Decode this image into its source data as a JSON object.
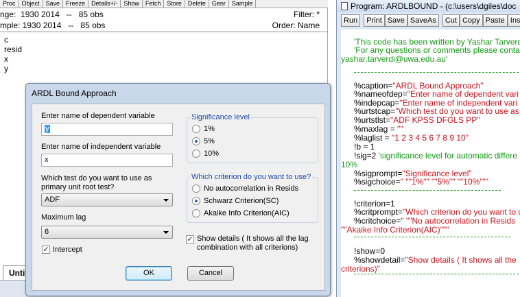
{
  "workfile": {
    "toolbar_items": [
      "Proc",
      "Object",
      "Save",
      "Freeze",
      "Details+/-",
      "Show",
      "Fetch",
      "Store",
      "Delete",
      "Genr",
      "Sample"
    ],
    "range_label": "nge:  1930 2014   --   85 obs",
    "filter_label": "Filter: *",
    "sample_label": "mple: 1930 2014   --   85 obs",
    "order_label": "Order: Name",
    "objects": [
      "c",
      "resid",
      "x",
      "y"
    ],
    "tab_label": "Untitled"
  },
  "program": {
    "title": "Program: ARDLBOUND - (c:\\users\\dgiles\\doc",
    "toolbar": [
      "Run",
      "Print",
      "Save",
      "SaveAs",
      "Cut",
      "Copy",
      "Paste",
      "Inse"
    ],
    "lines": [
      {
        "text": "'This code has been written by Yashar Tarverdi",
        "color": "g",
        "indent": 1
      },
      {
        "text": "'For any questions or comments please conta",
        "color": "g",
        "indent": 1
      },
      {
        "text": "yashar.tarverdi@uwa.edu.au'",
        "color": "g",
        "indent": 0
      },
      {
        "text": "%caption=\"ARDL Bound Approach\"",
        "color": "kr",
        "indent": 1
      },
      {
        "text": "%nameofdep=\"Enter name of dependent vari",
        "color": "kr",
        "indent": 1
      },
      {
        "text": "%indepcap=\"Enter name of independent vari",
        "color": "kr",
        "indent": 1
      },
      {
        "text": "%urtstcap=\"Which test do you want to use as",
        "color": "kr",
        "indent": 1
      },
      {
        "text": "%urtstlst=\"ADF KPSS DFGLS PP\"",
        "color": "kr",
        "indent": 1
      },
      {
        "text": "%maxlag = \"\"",
        "color": "kr",
        "indent": 1
      },
      {
        "text": "%laglist = \"1 2 3 4 5 6 7 8 9 10\"",
        "color": "kr",
        "indent": 1
      },
      {
        "text": "!b = 1",
        "color": "k",
        "indent": 1
      },
      {
        "text": "!sig=2 'significance level for automatic differe",
        "color": "kg",
        "indent": 1
      },
      {
        "text": "10%",
        "color": "g",
        "indent": 0
      },
      {
        "text": "%sigprompt=\"Significance level\"",
        "color": "kr",
        "indent": 1
      },
      {
        "text": "%sigchoice=\" \"\"1%\"\" \"\"5%\"\" \"\"10%\"\"\"",
        "color": "kr",
        "indent": 1
      },
      {
        "text": "!criterion=1",
        "color": "k",
        "indent": 1
      },
      {
        "text": "%critprompt=\"Which criterion do you want to u",
        "color": "kr",
        "indent": 1
      },
      {
        "text": "%critchoice=\" \"\"No autocorrelation in Resids",
        "color": "kr",
        "indent": 1
      },
      {
        "text": "\"\"Akaike Info Criterion(AIC)\"\"\"",
        "color": "r",
        "indent": 0
      },
      {
        "text": "!show=0",
        "color": "k",
        "indent": 1
      },
      {
        "text": "%showdetail=\"Show details ( It shows all the",
        "color": "kr",
        "indent": 1
      },
      {
        "text": "criterions)\"",
        "color": "r",
        "indent": 0
      }
    ]
  },
  "dialog": {
    "title": "ARDL Bound Approach",
    "dep_label": "Enter name of dependent variable",
    "dep_value": "y",
    "indep_label": "Enter name of independent variable",
    "indep_value": "x",
    "test_label_1": "Which test do you want to use as",
    "test_label_2": "primary unit root test?",
    "test_value": "ADF",
    "maxlag_label": "Maximum lag",
    "maxlag_value": "6",
    "intercept_label": "Intercept",
    "intercept_checked": true,
    "sig_group_title": "Significance level",
    "sig_options": [
      "1%",
      "5%",
      "10%"
    ],
    "sig_selected": "5%",
    "crit_group_title": "Which criterion do you want to use?",
    "crit_options": [
      "No autocorrelation in Resids",
      "Schwarz Criterion(SC)",
      "Akaike Info Criterion(AIC)"
    ],
    "crit_selected": "Schwarz Criterion(SC)",
    "show_details_1": "Show details ( It shows all the lag",
    "show_details_2": "combination with all criterions)",
    "show_details_checked": true,
    "ok_label": "OK",
    "cancel_label": "Cancel"
  },
  "colors": {
    "comment_green": "#119a11",
    "string_red": "#d0101a",
    "group_title_blue": "#1f4aa8",
    "dialog_frame": "#c8d7ea"
  }
}
